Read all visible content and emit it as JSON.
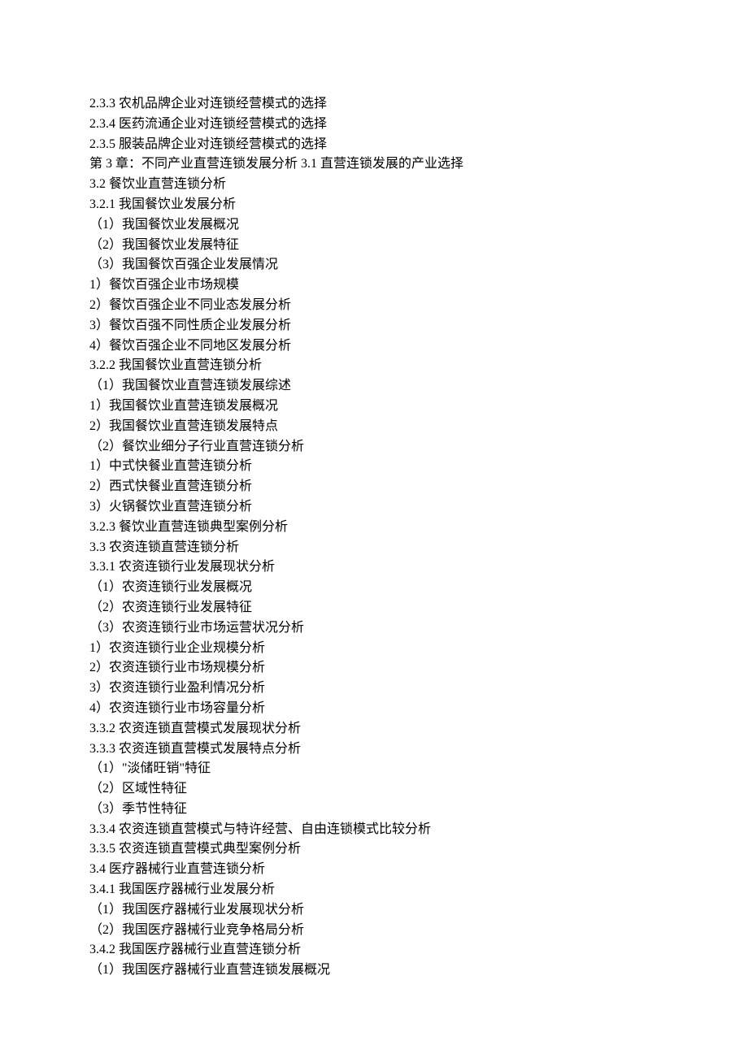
{
  "lines": [
    "2.3.3 农机品牌企业对连锁经营模式的选择",
    "2.3.4 医药流通企业对连锁经营模式的选择",
    "2.3.5 服装品牌企业对连锁经营模式的选择",
    "第 3 章：不同产业直营连锁发展分析 3.1 直营连锁发展的产业选择",
    "3.2 餐饮业直营连锁分析",
    "3.2.1 我国餐饮业发展分析",
    "（1）我国餐饮业发展概况",
    "（2）我国餐饮业发展特征",
    "（3）我国餐饮百强企业发展情况",
    "1）餐饮百强企业市场规模",
    "2）餐饮百强企业不同业态发展分析",
    "3）餐饮百强不同性质企业发展分析",
    "4）餐饮百强企业不同地区发展分析",
    "3.2.2 我国餐饮业直营连锁分析",
    "（1）我国餐饮业直营连锁发展综述",
    "1）我国餐饮业直营连锁发展概况",
    "2）我国餐饮业直营连锁发展特点",
    "（2）餐饮业细分子行业直营连锁分析",
    "1）中式快餐业直营连锁分析",
    "2）西式快餐业直营连锁分析",
    "3）火锅餐饮业直营连锁分析",
    "3.2.3 餐饮业直营连锁典型案例分析",
    "3.3 农资连锁直营连锁分析",
    "3.3.1 农资连锁行业发展现状分析",
    "（1）农资连锁行业发展概况",
    "（2）农资连锁行业发展特征",
    "（3）农资连锁行业市场运营状况分析",
    "1）农资连锁行业企业规模分析",
    "2）农资连锁行业市场规模分析",
    "3）农资连锁行业盈利情况分析",
    "4）农资连锁行业市场容量分析",
    "3.3.2 农资连锁直营模式发展现状分析",
    "3.3.3 农资连锁直营模式发展特点分析",
    "（1）\"淡储旺销\"特征",
    "（2）区域性特征",
    "（3）季节性特征",
    "3.3.4 农资连锁直营模式与特许经营、自由连锁模式比较分析",
    "3.3.5 农资连锁直营模式典型案例分析",
    "3.4 医疗器械行业直营连锁分析",
    "3.4.1 我国医疗器械行业发展分析",
    "（1）我国医疗器械行业发展现状分析",
    "（2）我国医疗器械行业竞争格局分析",
    "3.4.2 我国医疗器械行业直营连锁分析",
    "（1）我国医疗器械行业直营连锁发展概况"
  ]
}
